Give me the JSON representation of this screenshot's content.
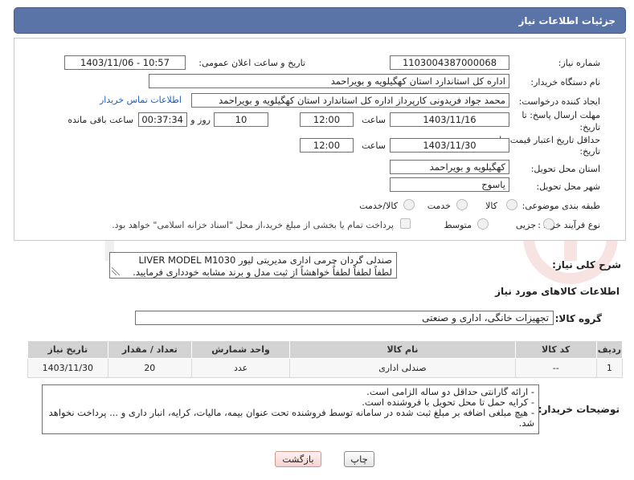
{
  "header": {
    "title": "جزئیات اطلاعات نیاز"
  },
  "fields": {
    "need_number_label": "شماره نیاز:",
    "need_number": "1103004387000068",
    "announce_label": "تاریخ و ساعت اعلان عمومی:",
    "announce_value": "1403/11/06 - 10:57",
    "buyer_org_label": "نام دستگاه خریدار:",
    "buyer_org": "اداره کل استاندارد استان کهگیلویه و بویراحمد",
    "creator_label": "ایجاد کننده درخواست:",
    "creator": "محمد جواد  فریدونی کارپرداز اداره کل استاندارد استان کهگیلویه و بویراحمد",
    "contact_link": "اطلاعات تماس خریدار",
    "deadline_label_1": "مهلت ارسال پاسخ: تا",
    "deadline_label_2": "تاریخ:",
    "deadline_date": "1403/11/16",
    "time_label": "ساعت",
    "deadline_time": "12:00",
    "days_value": "10",
    "days_label": "روز و",
    "remaining_time": "00:37:34",
    "remaining_label": "ساعت باقی مانده",
    "validity_label_1": "حداقل تاریخ اعتبار قیمت: تا",
    "validity_label_2": "تاریخ:",
    "validity_date": "1403/11/30",
    "validity_time": "12:00",
    "province_label": "استان محل تحویل:",
    "province": "کهگیلویه و بویراحمد",
    "city_label": "شهر محل تحویل:",
    "city": "یاسوج",
    "category_label": "طبقه بندی موضوعی:",
    "category_options": [
      "کالا",
      "خدمت",
      "کالا/خدمت"
    ],
    "process_label": "نوع فرآیند خرید :",
    "process_options": [
      "جزیی",
      "متوسط"
    ],
    "payment_note": "پرداخت تمام یا بخشی از مبلغ خرید،از محل \"اسناد خزانه اسلامی\" خواهد بود."
  },
  "description": {
    "label": "شرح کلی نیاز:",
    "line1": "صندلی گردان چرمی اداری مدیریتی لیور LIVER MODEL M1030",
    "line2": "لطفاً لطفاً لطفاً خواهشاً  از ثبت مدل و برند مشابه خودداری فرمایید."
  },
  "goods": {
    "section_title": "اطلاعات کالاهای مورد نیاز",
    "group_label": "گروه کالا:",
    "group_value": "تجهیزات خانگی، اداری و صنعتی",
    "columns": [
      "ردیف",
      "کد کالا",
      "نام کالا",
      "واحد شمارش",
      "تعداد / مقدار",
      "تاریخ نیاز"
    ],
    "rows": [
      [
        "1",
        "--",
        "صندلی اداری",
        "عدد",
        "20",
        "1403/11/30"
      ]
    ]
  },
  "buyer_notes": {
    "label": "توضیحات خریدار:",
    "lines": [
      "- ارائه گارانتی حداقل دو ساله الزامی است.",
      "- کرایه حمل تا محل تحویل با فروشنده است.",
      "- هیچ مبلغی اضافه بر مبلغ ثبت شده در سامانه توسط فروشنده تحت عنوان بیمه، مالیات، کرایه، انبار داری و ... پرداخت نخواهد شد."
    ]
  },
  "buttons": {
    "print": "چاپ",
    "back": "بازگشت"
  },
  "watermark": "AriaTender.neT",
  "colors": {
    "header_bg": "#5a74a8",
    "link": "#1f5fbf",
    "table_header": "#d3d3d3"
  }
}
